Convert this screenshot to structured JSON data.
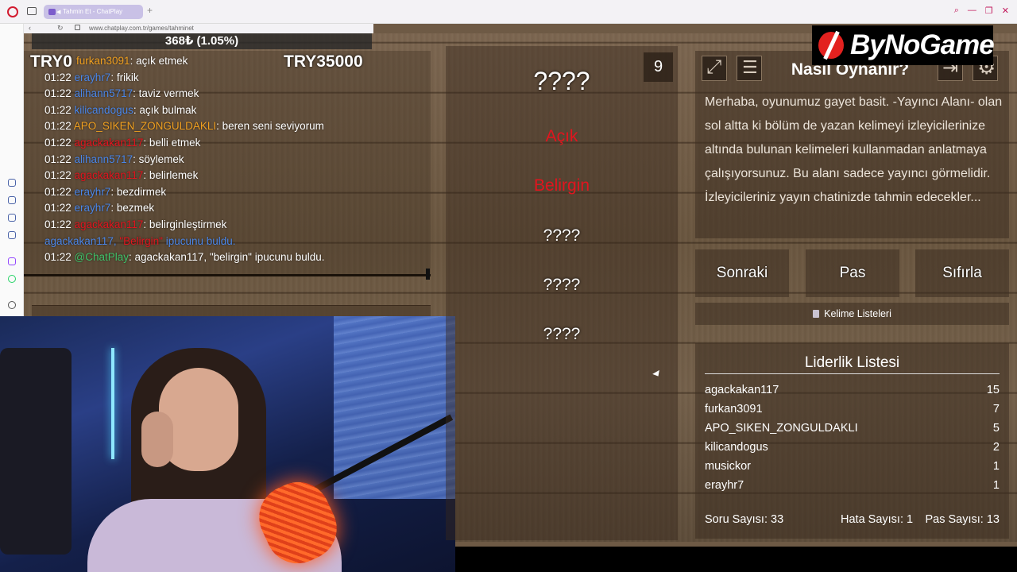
{
  "browser": {
    "tab_title": "Tahmin Et - ChatPlay",
    "new_tab": "+",
    "url": "www.chatplay.com.tr/games/tahminet"
  },
  "stream": {
    "stat_bar": "368₺ (1.05%)",
    "try_left": "TRY0",
    "try_right": "TRY35000"
  },
  "chat": {
    "messages": [
      {
        "time": "",
        "user": "furkan3091",
        "user_color": "#f0a020",
        "msg": ": açık etmek"
      },
      {
        "time": "01:22",
        "user": "erayhr7",
        "user_color": "#4a86e8",
        "msg": ": frikik"
      },
      {
        "time": "01:22",
        "user": "alihann5717",
        "user_color": "#4a86e8",
        "msg": ": taviz vermek"
      },
      {
        "time": "01:22",
        "user": "kilicandogus",
        "user_color": "#4a86e8",
        "msg": ": açık bulmak"
      },
      {
        "time": "01:22",
        "user": "APO_SIKEN_ZONGULDAKLI",
        "user_color": "#f0a020",
        "msg": ": beren seni seviyorum"
      },
      {
        "time": "01:22",
        "user": "agackakan117",
        "user_color": "#e2141e",
        "msg": ": belli etmek"
      },
      {
        "time": "01:22",
        "user": "alihann5717",
        "user_color": "#4a86e8",
        "msg": ": söylemek"
      },
      {
        "time": "01:22",
        "user": "agackakan117",
        "user_color": "#e2141e",
        "msg": ": belirlemek"
      },
      {
        "time": "01:22",
        "user": "erayhr7",
        "user_color": "#4a86e8",
        "msg": ": bezdirmek"
      },
      {
        "time": "01:22",
        "user": "erayhr7",
        "user_color": "#4a86e8",
        "msg": ": bezmek"
      },
      {
        "time": "01:22",
        "user": "agackakan117",
        "user_color": "#e2141e",
        "msg": ": belirginleştirmek"
      }
    ],
    "system_line": {
      "user": "agackakan117,",
      "hint": "\"Belirgin\"",
      "text": " ipucunu buldu."
    },
    "bot_line": {
      "time": "01:22",
      "user": "@ChatPlay",
      "user_color": "#3fc26a",
      "msg": ": agackakan117, \"belirgin\" ipucunu buldu."
    }
  },
  "game": {
    "counter": "9",
    "words": [
      {
        "text": "????",
        "kind": "big"
      },
      {
        "text": "Açık",
        "kind": "hint"
      },
      {
        "text": "Belirgin",
        "kind": "hint"
      },
      {
        "text": "????",
        "kind": "q"
      },
      {
        "text": "????",
        "kind": "q"
      },
      {
        "text": "????",
        "kind": "q"
      }
    ]
  },
  "info": {
    "title": "Nasıl Oynanır?",
    "text": "Merhaba, oyunumuz gayet basit. -Yayıncı Alanı- olan sol altta ki bölüm de yazan kelimeyi izleyicilerinize altında bulunan kelimeleri kullanmadan anlatmaya çalışıyorsunuz. Bu alanı sadece yayıncı görmelidir. İzleyicileriniz yayın chatinizde tahmin edecekler..."
  },
  "buttons": {
    "next": "Sonraki",
    "pass": "Pas",
    "reset": "Sıfırla",
    "word_lists": "Kelime Listeleri"
  },
  "brand": "ByNoGame",
  "leaderboard": {
    "title": "Liderlik Listesi",
    "rows": [
      {
        "name": "agackakan117",
        "score": "15"
      },
      {
        "name": "furkan3091",
        "score": "7"
      },
      {
        "name": "APO_SIKEN_ZONGULDAKLI",
        "score": "5"
      },
      {
        "name": "kilicandogus",
        "score": "2"
      },
      {
        "name": "musickor",
        "score": "1"
      },
      {
        "name": "erayhr7",
        "score": "1"
      }
    ],
    "stats": {
      "questions": "Soru Sayısı: 33",
      "errors": "Hata Sayısı: 1",
      "passes": "Pas Sayısı: 13"
    }
  }
}
